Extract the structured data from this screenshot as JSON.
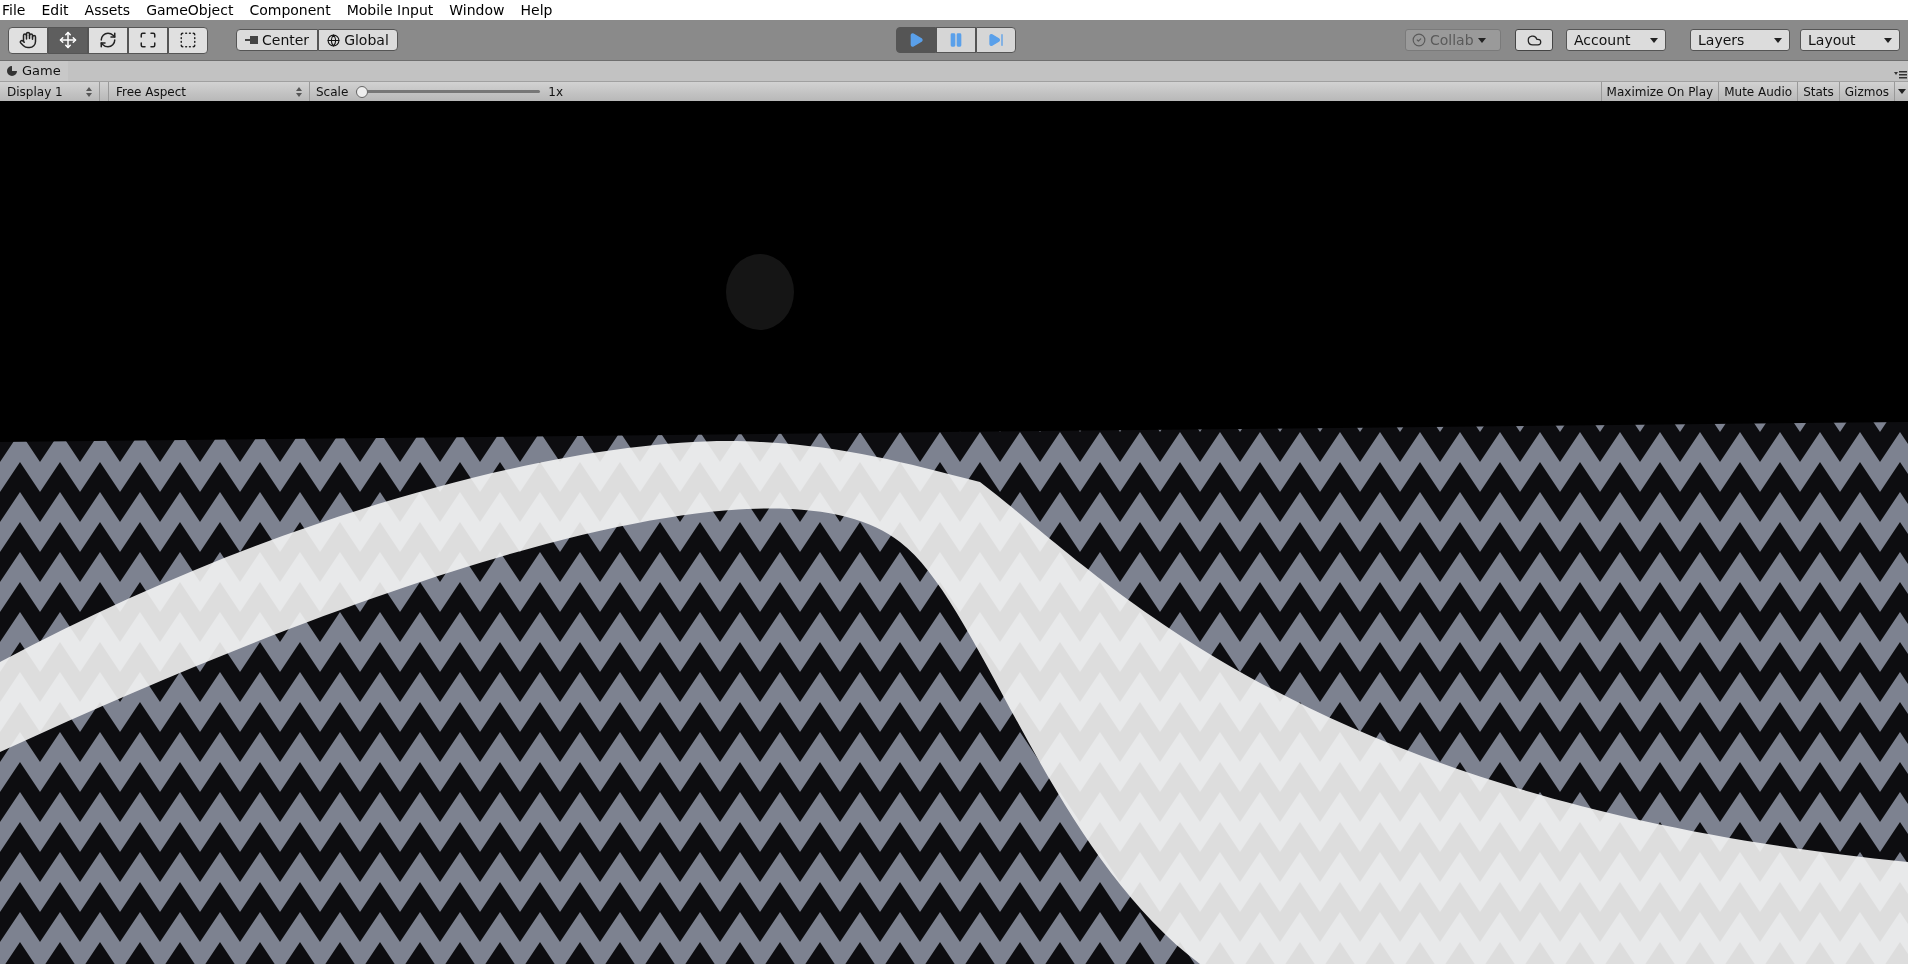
{
  "menu": [
    "File",
    "Edit",
    "Assets",
    "GameObject",
    "Component",
    "Mobile Input",
    "Window",
    "Help"
  ],
  "tools": [
    {
      "kind": "hand",
      "selected": false
    },
    {
      "kind": "move",
      "selected": true
    },
    {
      "kind": "rotate",
      "selected": false
    },
    {
      "kind": "scale",
      "selected": false
    },
    {
      "kind": "rect",
      "selected": false
    }
  ],
  "pivot": [
    {
      "kind": "pivot",
      "label": "Center"
    },
    {
      "kind": "space",
      "label": "Global"
    }
  ],
  "playback": [
    {
      "kind": "play",
      "selected": true
    },
    {
      "kind": "pause",
      "selected": false
    },
    {
      "kind": "step",
      "selected": false
    }
  ],
  "collab": {
    "label": "Collab",
    "disabled": true
  },
  "account": {
    "label": "Account"
  },
  "layers": {
    "label": "Layers"
  },
  "layout": {
    "label": "Layout"
  },
  "tab": {
    "label": "Game"
  },
  "game_toolbar": {
    "display": "Display 1",
    "aspect": "Free Aspect",
    "scale_label": "Scale",
    "scale": {
      "level": 0
    },
    "scale_reading": "1x",
    "toggles": [
      "Maximize On Play",
      "Mute Audio",
      "Stats",
      "Gizmos"
    ]
  }
}
